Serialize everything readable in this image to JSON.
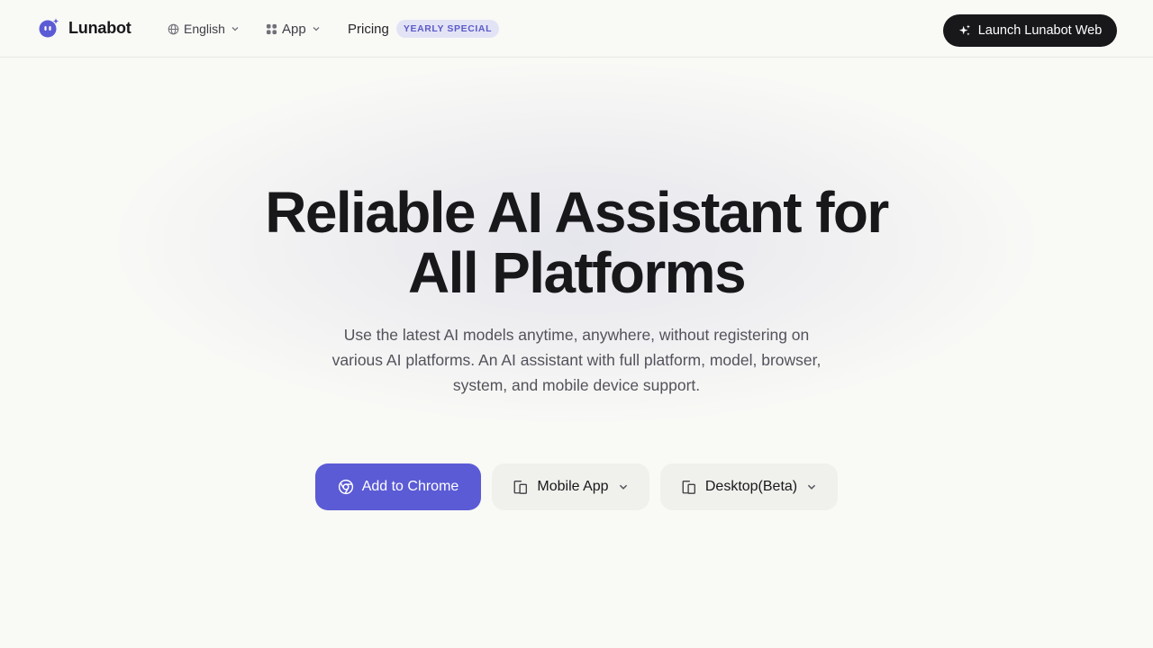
{
  "header": {
    "brand_name": "Lunabot",
    "language_label": "English",
    "app_label": "App",
    "pricing_label": "Pricing",
    "pricing_badge": "YEARLY SPECIAL",
    "launch_label": "Launch Lunabot Web"
  },
  "hero": {
    "title_line1": "Reliable AI Assistant for",
    "title_line2": "All Platforms",
    "subtitle_line1": "Use the latest AI models anytime, anywhere, without registering on",
    "subtitle_line2": "various AI platforms. An AI assistant with full platform, model, browser,",
    "subtitle_line3": "system, and mobile device support."
  },
  "cta": {
    "chrome_label": "Add to Chrome",
    "mobile_label": "Mobile App",
    "desktop_label": "Desktop(Beta)"
  },
  "colors": {
    "accent": "#5b5bd6",
    "dark": "#18181b",
    "background": "#f9f9f6",
    "badge_bg": "#e3e3f6"
  },
  "icons": {
    "brand": "lunabot-logo-icon",
    "language": "globe-icon",
    "app": "grid-icon",
    "launch": "sparkle-icon",
    "chrome": "chrome-icon",
    "mobile": "devices-icon",
    "desktop": "devices-icon",
    "dropdown": "chevron-down-icon"
  }
}
